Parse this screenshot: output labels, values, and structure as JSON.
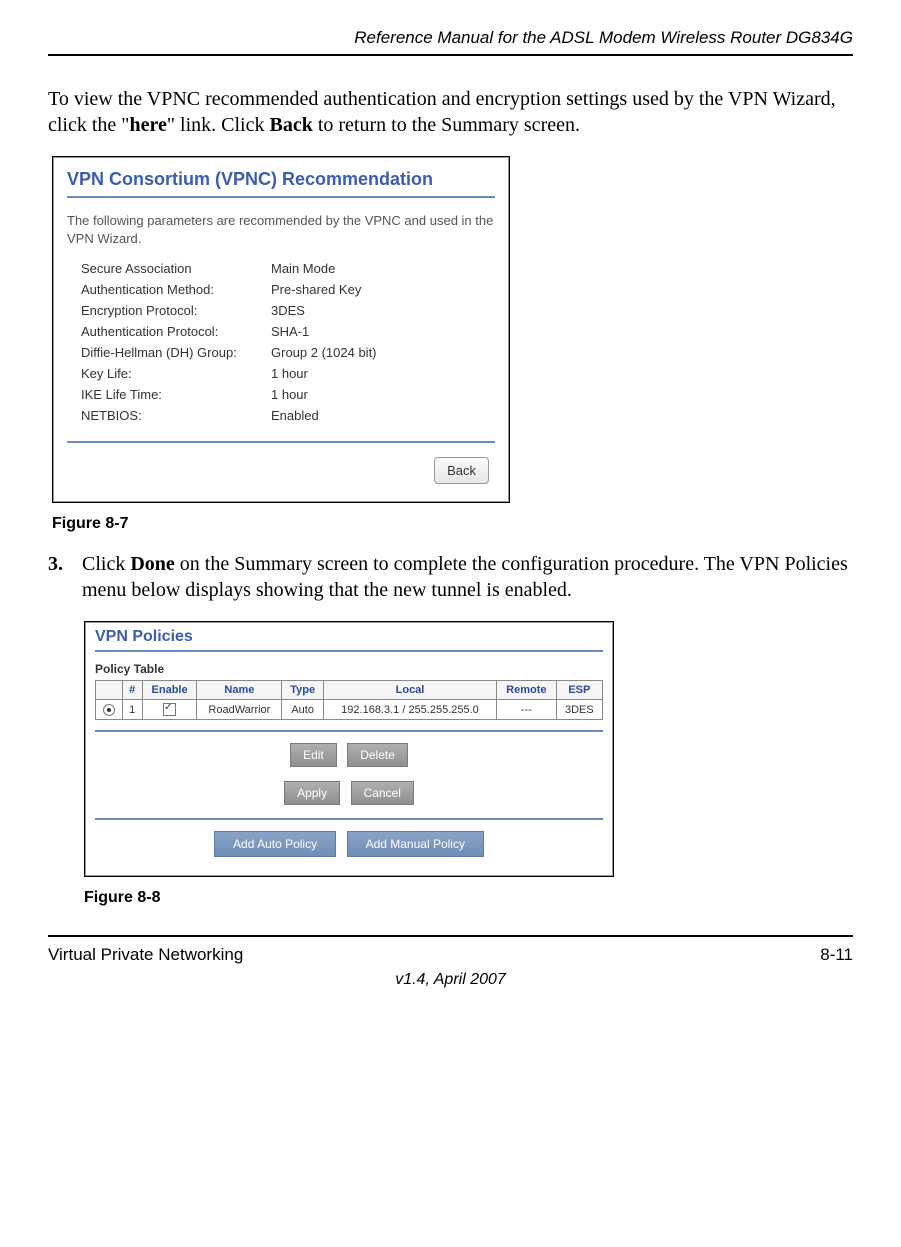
{
  "header": {
    "title": "Reference Manual for the ADSL Modem Wireless Router DG834G"
  },
  "intro_paragraph": {
    "pre": "To view the VPNC recommended authentication and encryption settings used by the VPN Wizard, click the \"",
    "link": "here",
    "mid": "\" link. Click ",
    "bold": "Back",
    "post": " to return to the Summary screen."
  },
  "figure1": {
    "title": "VPN Consortium (VPNC) Recommendation",
    "intro": "The following parameters are recommended by the VPNC and used in the VPN Wizard.",
    "params": [
      {
        "k": "Secure Association",
        "v": "Main Mode"
      },
      {
        "k": "Authentication Method:",
        "v": "Pre-shared Key"
      },
      {
        "k": "Encryption Protocol:",
        "v": "3DES"
      },
      {
        "k": "Authentication Protocol:",
        "v": "SHA-1"
      },
      {
        "k": "Diffie-Hellman (DH) Group:",
        "v": "Group 2 (1024 bit)"
      },
      {
        "k": "Key Life:",
        "v": "1 hour"
      },
      {
        "k": "IKE Life Time:",
        "v": "1 hour"
      },
      {
        "k": "NETBIOS:",
        "v": "Enabled"
      }
    ],
    "back_button": "Back",
    "caption": "Figure 8-7"
  },
  "step3": {
    "num": "3.",
    "pre": "Click ",
    "bold": "Done",
    "post": " on the Summary screen to complete the configuration procedure. The VPN Policies menu below displays showing that the new tunnel is enabled."
  },
  "figure2": {
    "title": "VPN Policies",
    "subhead": "Policy Table",
    "headers": [
      "",
      "#",
      "Enable",
      "Name",
      "Type",
      "Local",
      "Remote",
      "ESP"
    ],
    "row": {
      "num": "1",
      "name": "RoadWarrior",
      "type": "Auto",
      "local": "192.168.3.1 / 255.255.255.0",
      "remote": "---",
      "esp": "3DES"
    },
    "buttons_row1": [
      "Edit",
      "Delete"
    ],
    "buttons_row2": [
      "Apply",
      "Cancel"
    ],
    "buttons_row3": [
      "Add Auto Policy",
      "Add Manual Policy"
    ],
    "caption": "Figure 8-8"
  },
  "footer": {
    "left": "Virtual Private Networking",
    "right": "8-11",
    "center": "v1.4, April 2007"
  }
}
